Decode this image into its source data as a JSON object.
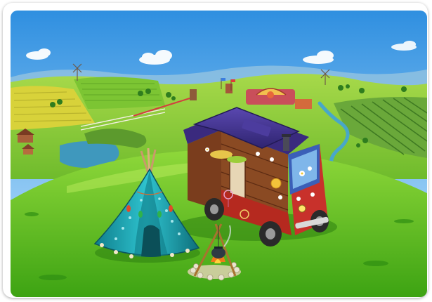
{
  "scene": {
    "palette": {
      "sky_top": "#2f8fe0",
      "sky_bottom": "#bfe6ff",
      "hill_far": "#8fcf3a",
      "hill_near": "#4fb51d",
      "field_yellow": "#d7d23a",
      "river": "#47a6c8",
      "van_body": "#c8312b",
      "van_roof": "#43338c",
      "van_wood": "#8a4a23",
      "tent": "#1aa6b4",
      "tent_dark": "#0f6f7b"
    },
    "icons": [
      "windmill-icon",
      "flag-icon",
      "campfire-icon",
      "kettle-icon",
      "flower-icon",
      "sun-icon",
      "dreamcatcher-icon"
    ]
  }
}
